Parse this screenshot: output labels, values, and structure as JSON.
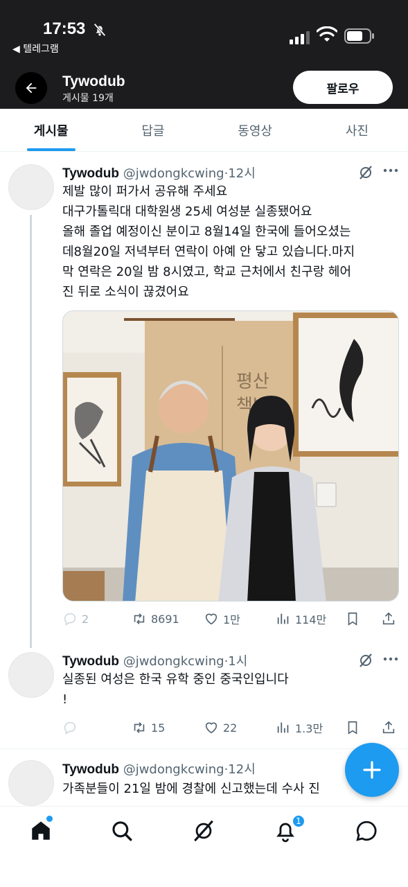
{
  "status_bar": {
    "time": "17:53",
    "back_app": "◀ 텔레그램"
  },
  "profile": {
    "name": "Tywodub",
    "post_count": "게시물 19개",
    "follow_label": "팔로우"
  },
  "tabs": [
    {
      "label": "게시물",
      "active": true
    },
    {
      "label": "답글",
      "active": false
    },
    {
      "label": "동영상",
      "active": false
    },
    {
      "label": "사진",
      "active": false
    }
  ],
  "tweets": [
    {
      "name": "Tywodub",
      "handle": "@jwdongkcwing",
      "time": "·12시",
      "lines": [
        "제발 많이 퍼가서 공유해 주세요",
        "대구가톨릭대 대학원생 25세 여성분 실종됐어요",
        "올해 졸업 예정이신 분이고 8월14일 한국에 들어오셨는",
        "데8월20일 저녁부터 연락이 아예 안 닿고 있습니다.마지",
        "막 연락은 20일 밤 8시였고, 학교 근처에서 친구랑 헤어",
        "진 뒤로 소식이 끊겼어요"
      ],
      "replies": "2",
      "retweets": "8691",
      "likes": "1만",
      "views": "114만"
    },
    {
      "name": "Tywodub",
      "handle": "@jwdongkcwing",
      "time": "·1시",
      "lines": [
        "실종된 여성은 한국 유학 중인 중국인입니다",
        "!"
      ],
      "replies": "",
      "retweets": "15",
      "likes": "22",
      "views": "1.3만"
    },
    {
      "name": "Tywodub",
      "handle": "@jwdongkcwing",
      "time": "·12시",
      "lines": [
        "가족분들이 21일 밤에 경찰에 신고했는데 수사 진"
      ]
    }
  ],
  "nav": {
    "notification_count": "1"
  },
  "colors": {
    "accent": "#1d9bf0",
    "header_bg": "#1c1c1e",
    "muted": "#536471"
  }
}
